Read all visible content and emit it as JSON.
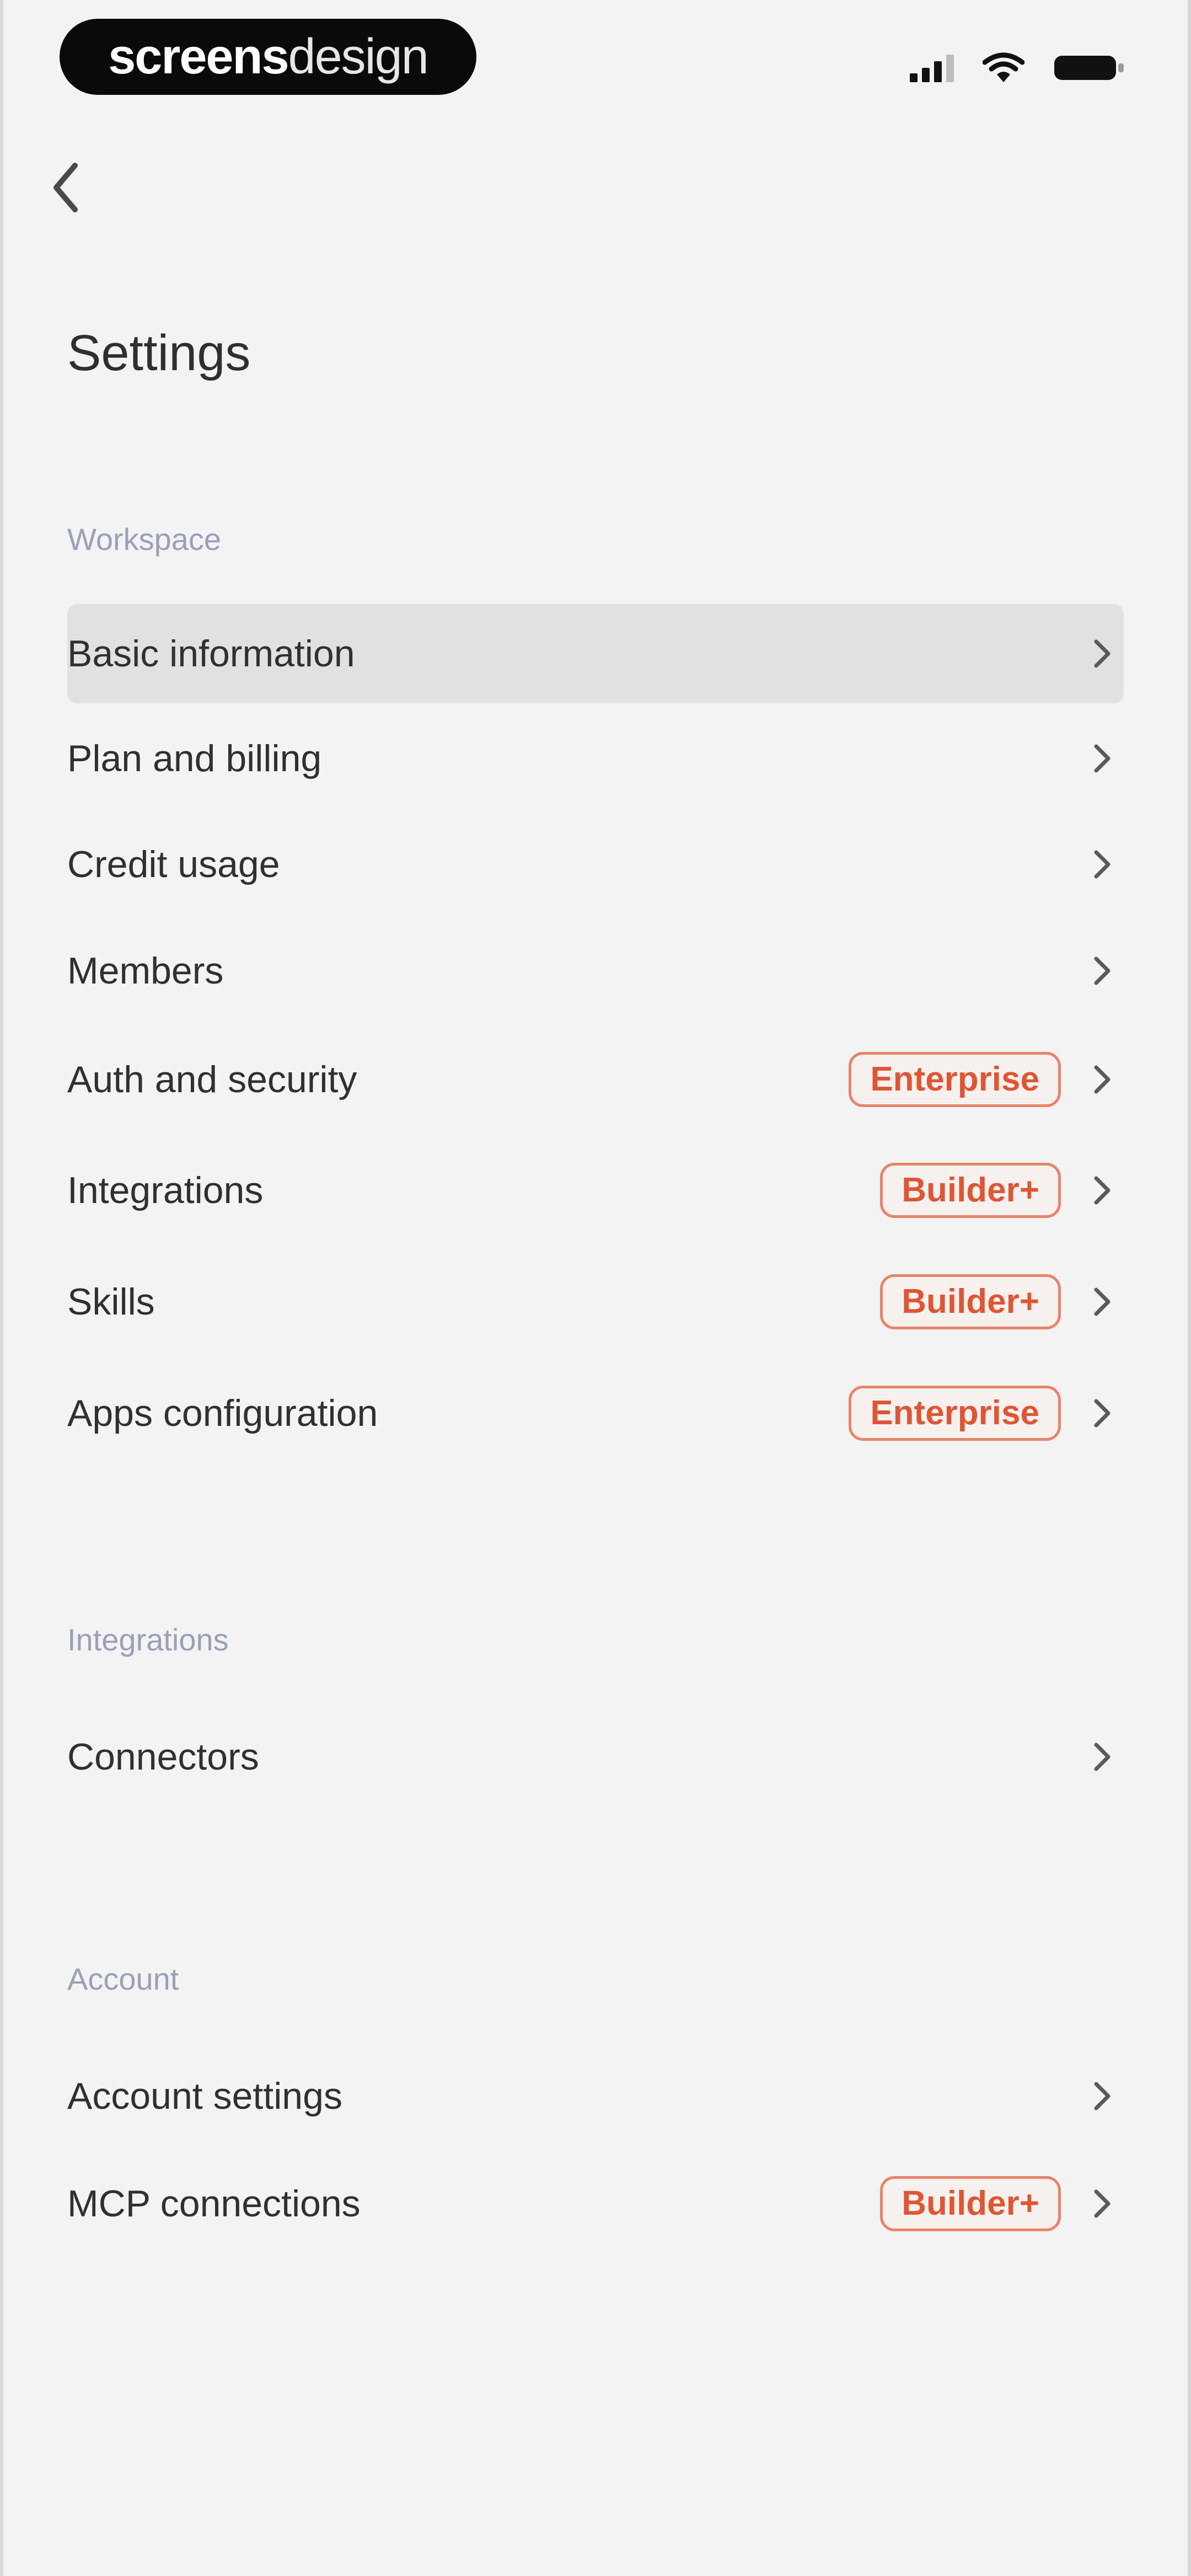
{
  "status_bar": {
    "brand": {
      "part1": "screens",
      "part2": "design"
    },
    "icons": [
      "signal-icon",
      "wifi-icon",
      "battery-icon"
    ]
  },
  "header": {
    "back_icon": "chevron-left-icon",
    "title": "Settings"
  },
  "sections": {
    "workspace": {
      "label": "Workspace",
      "items": [
        {
          "label": "Basic information",
          "badge": "",
          "active": true
        },
        {
          "label": "Plan and billing",
          "badge": ""
        },
        {
          "label": "Credit usage",
          "badge": ""
        },
        {
          "label": "Members",
          "badge": ""
        },
        {
          "label": "Auth and security",
          "badge": "Enterprise"
        },
        {
          "label": "Integrations",
          "badge": "Builder+"
        },
        {
          "label": "Skills",
          "badge": "Builder+"
        },
        {
          "label": "Apps configuration",
          "badge": "Enterprise"
        }
      ]
    },
    "integrations": {
      "label": "Integrations",
      "items": [
        {
          "label": "Connectors",
          "badge": ""
        }
      ]
    },
    "account": {
      "label": "Account",
      "items": [
        {
          "label": "Account settings",
          "badge": ""
        },
        {
          "label": "MCP connections",
          "badge": "Builder+"
        }
      ]
    }
  },
  "colors": {
    "background": "#f3f3f3",
    "badge_text": "#de5634",
    "badge_border": "#e8846b",
    "section_label": "#9aa0b8",
    "active_row": "#e1e1e1"
  }
}
